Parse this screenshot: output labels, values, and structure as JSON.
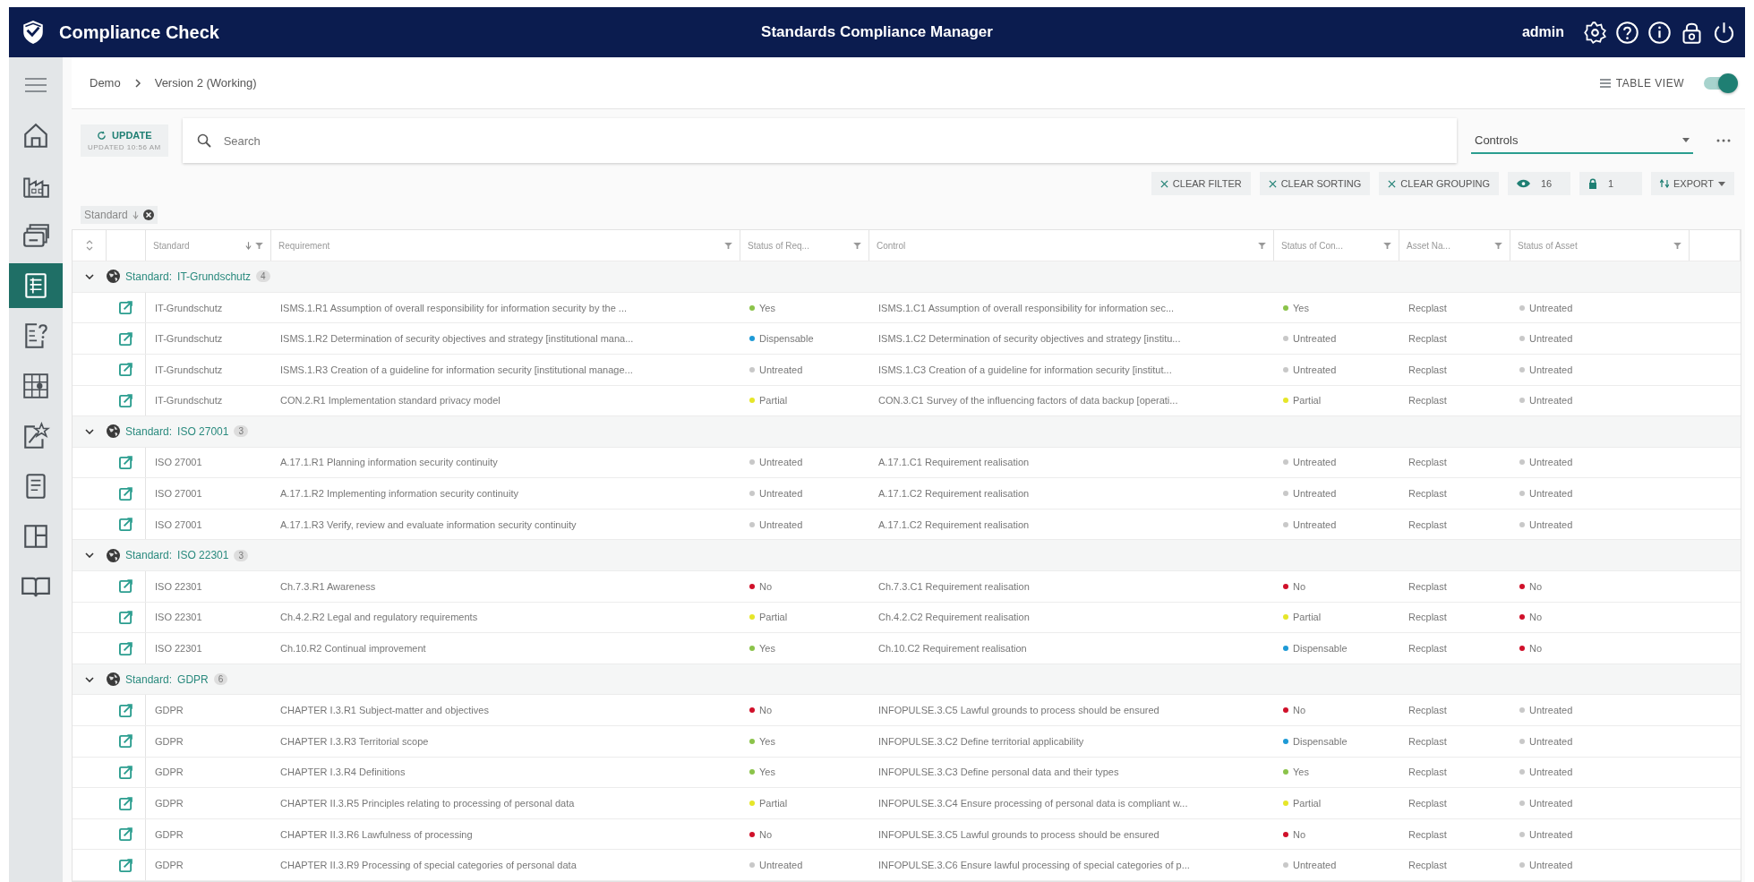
{
  "header": {
    "app_name": "Compliance Check",
    "title": "Standards Compliance Manager",
    "user": "admin"
  },
  "sidebar": {
    "items": [
      {
        "kind": "home",
        "selected": false
      },
      {
        "kind": "factory",
        "selected": false
      },
      {
        "kind": "cards",
        "selected": false
      },
      {
        "kind": "table",
        "selected": true
      },
      {
        "kind": "question",
        "selected": false
      },
      {
        "kind": "grid",
        "selected": false
      },
      {
        "kind": "star",
        "selected": false
      },
      {
        "kind": "document",
        "selected": false
      },
      {
        "kind": "columns",
        "selected": false
      },
      {
        "kind": "book",
        "selected": false
      }
    ]
  },
  "breadcrumb": [
    "Demo",
    "Version 2 (Working)"
  ],
  "table_view": {
    "label": "TABLE VIEW",
    "on": true
  },
  "update": {
    "label": "UPDATE",
    "subtitle": "UPDATED 10:56 AM"
  },
  "search": {
    "placeholder": "Search"
  },
  "view_select": {
    "value": "Controls"
  },
  "actions": {
    "clear_filter": "CLEAR FILTER",
    "clear_sorting": "CLEAR SORTING",
    "clear_grouping": "CLEAR GROUPING",
    "visible_count": "16",
    "locked_count": "1",
    "export": "EXPORT"
  },
  "group_chip": "Standard",
  "table": {
    "columns": [
      "Standard",
      "Requirement",
      "Status of Req...",
      "Control",
      "Status of Con...",
      "Asset Na...",
      "Status of Asset"
    ],
    "groups": [
      {
        "label": "Standard:",
        "value": "IT-Grundschutz",
        "count": "4",
        "expanded": true,
        "rows": [
          {
            "standard": "IT-Grundschutz",
            "requirement": "ISMS.1.R1 Assumption of overall responsibility for information security by the ...",
            "req_status": {
              "label": "Yes",
              "color": "#8bc34a"
            },
            "control": "ISMS.1.C1 Assumption of overall responsibility for information sec...",
            "con_status": {
              "label": "Yes",
              "color": "#8bc34a"
            },
            "asset": "Recplast",
            "asset_status": {
              "label": "Untreated",
              "color": "#c8c8c8"
            }
          },
          {
            "standard": "IT-Grundschutz",
            "requirement": "ISMS.1.R2 Determination of security objectives and strategy [institutional mana...",
            "req_status": {
              "label": "Dispensable",
              "color": "#1e9ad6"
            },
            "control": "ISMS.1.C2 Determination of security objectives and strategy [institu...",
            "con_status": {
              "label": "Untreated",
              "color": "#c8c8c8"
            },
            "asset": "Recplast",
            "asset_status": {
              "label": "Untreated",
              "color": "#c8c8c8"
            }
          },
          {
            "standard": "IT-Grundschutz",
            "requirement": "ISMS.1.R3 Creation of a guideline for information security [institutional manage...",
            "req_status": {
              "label": "Untreated",
              "color": "#c8c8c8"
            },
            "control": "ISMS.1.C3 Creation of a guideline for information security [institut...",
            "con_status": {
              "label": "Untreated",
              "color": "#c8c8c8"
            },
            "asset": "Recplast",
            "asset_status": {
              "label": "Untreated",
              "color": "#c8c8c8"
            }
          },
          {
            "standard": "IT-Grundschutz",
            "requirement": "CON.2.R1 Implementation standard privacy model",
            "req_status": {
              "label": "Partial",
              "color": "#e6e629"
            },
            "control": "CON.3.C1 Survey of the influencing factors of data backup [operati...",
            "con_status": {
              "label": "Partial",
              "color": "#e6e629"
            },
            "asset": "Recplast",
            "asset_status": {
              "label": "Untreated",
              "color": "#c8c8c8"
            }
          }
        ]
      },
      {
        "label": "Standard:",
        "value": "ISO 27001",
        "count": "3",
        "expanded": true,
        "rows": [
          {
            "standard": "ISO 27001",
            "requirement": "A.17.1.R1 Planning information security continuity",
            "req_status": {
              "label": "Untreated",
              "color": "#c8c8c8"
            },
            "control": "A.17.1.C1 Requirement realisation",
            "con_status": {
              "label": "Untreated",
              "color": "#c8c8c8"
            },
            "asset": "Recplast",
            "asset_status": {
              "label": "Untreated",
              "color": "#c8c8c8"
            }
          },
          {
            "standard": "ISO 27001",
            "requirement": "A.17.1.R2 Implementing information security continuity",
            "req_status": {
              "label": "Untreated",
              "color": "#c8c8c8"
            },
            "control": "A.17.1.C2 Requirement realisation",
            "con_status": {
              "label": "Untreated",
              "color": "#c8c8c8"
            },
            "asset": "Recplast",
            "asset_status": {
              "label": "Untreated",
              "color": "#c8c8c8"
            }
          },
          {
            "standard": "ISO 27001",
            "requirement": "A.17.1.R3 Verify, review and evaluate information security continuity",
            "req_status": {
              "label": "Untreated",
              "color": "#c8c8c8"
            },
            "control": "A.17.1.C2 Requirement realisation",
            "con_status": {
              "label": "Untreated",
              "color": "#c8c8c8"
            },
            "asset": "Recplast",
            "asset_status": {
              "label": "Untreated",
              "color": "#c8c8c8"
            }
          }
        ]
      },
      {
        "label": "Standard:",
        "value": "ISO 22301",
        "count": "3",
        "expanded": true,
        "rows": [
          {
            "standard": "ISO 22301",
            "requirement": "Ch.7.3.R1 Awareness",
            "req_status": {
              "label": "No",
              "color": "#d0102a"
            },
            "control": "Ch.7.3.C1 Requirement realisation",
            "con_status": {
              "label": "No",
              "color": "#d0102a"
            },
            "asset": "Recplast",
            "asset_status": {
              "label": "No",
              "color": "#d0102a"
            }
          },
          {
            "standard": "ISO 22301",
            "requirement": "Ch.4.2.R2 Legal and regulatory requirements",
            "req_status": {
              "label": "Partial",
              "color": "#e6e629"
            },
            "control": "Ch.4.2.C2 Requirement realisation",
            "con_status": {
              "label": "Partial",
              "color": "#e6e629"
            },
            "asset": "Recplast",
            "asset_status": {
              "label": "No",
              "color": "#d0102a"
            }
          },
          {
            "standard": "ISO 22301",
            "requirement": "Ch.10.R2 Continual improvement",
            "req_status": {
              "label": "Yes",
              "color": "#8bc34a"
            },
            "control": "Ch.10.C2 Requirement realisation",
            "con_status": {
              "label": "Dispensable",
              "color": "#1e9ad6"
            },
            "asset": "Recplast",
            "asset_status": {
              "label": "No",
              "color": "#d0102a"
            }
          }
        ]
      },
      {
        "label": "Standard:",
        "value": "GDPR",
        "count": "6",
        "expanded": true,
        "rows": [
          {
            "standard": "GDPR",
            "requirement": "CHAPTER I.3.R1 Subject-matter and objectives",
            "req_status": {
              "label": "No",
              "color": "#d0102a"
            },
            "control": "INFOPULSE.3.C5 Lawful grounds to process should be ensured",
            "con_status": {
              "label": "No",
              "color": "#d0102a"
            },
            "asset": "Recplast",
            "asset_status": {
              "label": "Untreated",
              "color": "#c8c8c8"
            }
          },
          {
            "standard": "GDPR",
            "requirement": "CHAPTER I.3.R3 Territorial scope",
            "req_status": {
              "label": "Yes",
              "color": "#8bc34a"
            },
            "control": "INFOPULSE.3.C2 Define territorial applicability",
            "con_status": {
              "label": "Dispensable",
              "color": "#1e9ad6"
            },
            "asset": "Recplast",
            "asset_status": {
              "label": "Untreated",
              "color": "#c8c8c8"
            }
          },
          {
            "standard": "GDPR",
            "requirement": "CHAPTER I.3.R4 Definitions",
            "req_status": {
              "label": "Yes",
              "color": "#8bc34a"
            },
            "control": "INFOPULSE.3.C3 Define personal data and their types",
            "con_status": {
              "label": "Yes",
              "color": "#8bc34a"
            },
            "asset": "Recplast",
            "asset_status": {
              "label": "Untreated",
              "color": "#c8c8c8"
            }
          },
          {
            "standard": "GDPR",
            "requirement": "CHAPTER II.3.R5 Principles relating to processing of personal data",
            "req_status": {
              "label": "Partial",
              "color": "#e6e629"
            },
            "control": "INFOPULSE.3.C4 Ensure processing of personal data is compliant w...",
            "con_status": {
              "label": "Partial",
              "color": "#e6e629"
            },
            "asset": "Recplast",
            "asset_status": {
              "label": "Untreated",
              "color": "#c8c8c8"
            }
          },
          {
            "standard": "GDPR",
            "requirement": "CHAPTER II.3.R6 Lawfulness of processing",
            "req_status": {
              "label": "No",
              "color": "#d0102a"
            },
            "control": "INFOPULSE.3.C5 Lawful grounds to process should be ensured",
            "con_status": {
              "label": "No",
              "color": "#d0102a"
            },
            "asset": "Recplast",
            "asset_status": {
              "label": "Untreated",
              "color": "#c8c8c8"
            }
          },
          {
            "standard": "GDPR",
            "requirement": "CHAPTER II.3.R9 Processing of special categories of personal data",
            "req_status": {
              "label": "Untreated",
              "color": "#c8c8c8"
            },
            "control": "INFOPULSE.3.C6 Ensure lawful processing of special categories of p...",
            "con_status": {
              "label": "Untreated",
              "color": "#c8c8c8"
            },
            "asset": "Recplast",
            "asset_status": {
              "label": "Untreated",
              "color": "#c8c8c8"
            }
          }
        ]
      }
    ]
  }
}
